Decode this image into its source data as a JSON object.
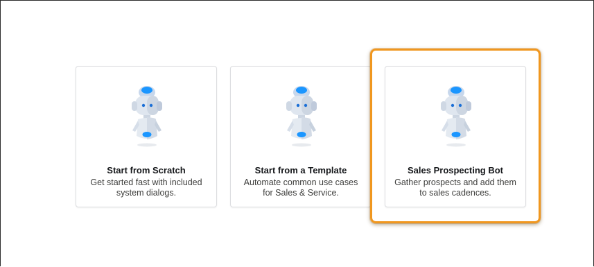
{
  "cards": [
    {
      "title": "Start from Scratch",
      "description": "Get started fast with included system dialogs.",
      "icon": "einstein-bot-icon"
    },
    {
      "title": "Start from a Template",
      "description": "Automate common use cases for Sales & Service.",
      "icon": "einstein-bot-icon"
    },
    {
      "title": "Sales Prospecting Bot",
      "description": "Gather prospects and add them to sales cadences.",
      "icon": "einstein-bot-icon",
      "highlighted": true
    }
  ],
  "colors": {
    "highlight": "#f0971f",
    "bot_blue": "#1b96ff",
    "bot_light": "#d9e6f7",
    "card_border": "#dcdde0"
  }
}
